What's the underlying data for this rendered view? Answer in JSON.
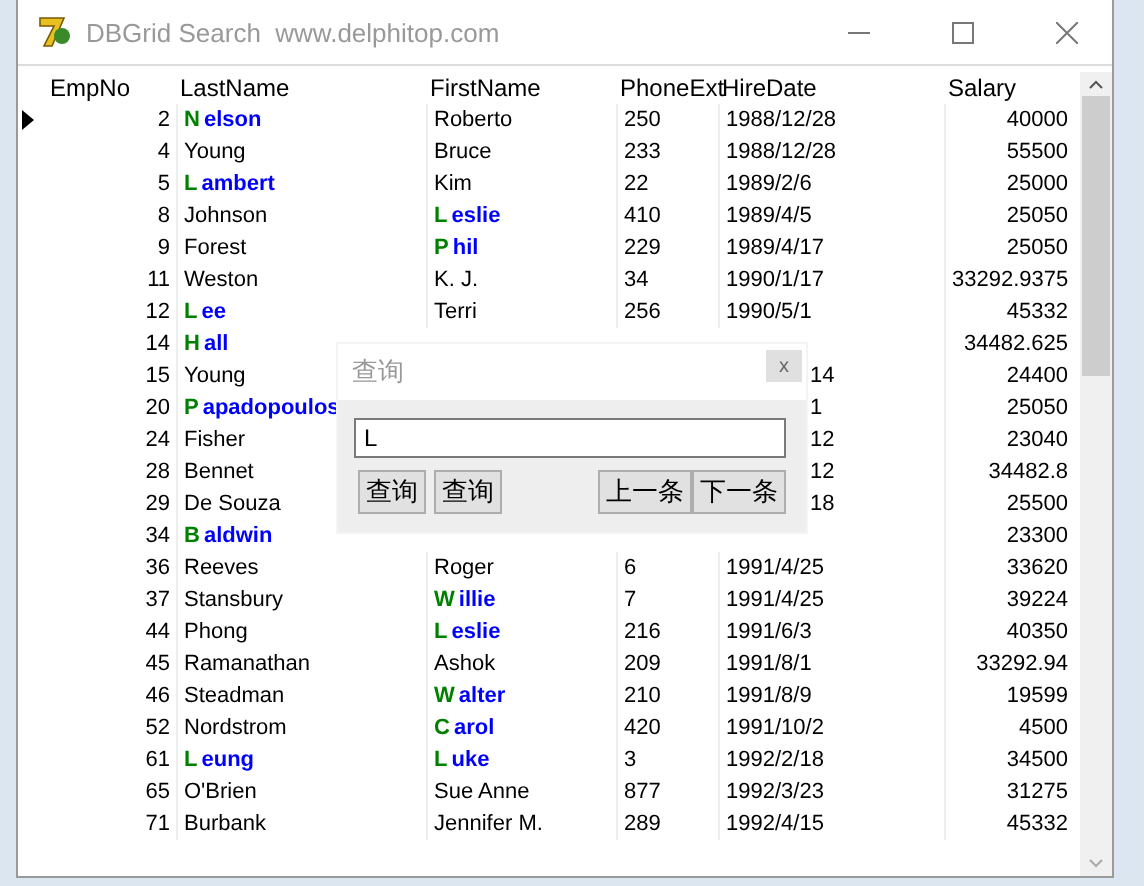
{
  "window": {
    "title": "DBGrid Search  www.delphitop.com"
  },
  "grid": {
    "columns": [
      "EmpNo",
      "LastName",
      "FirstName",
      "PhoneExt",
      "HireDate",
      "Salary"
    ],
    "rows": [
      {
        "current": true,
        "emp": "2",
        "last": {
          "match": "N",
          "rest": "elson"
        },
        "first": {
          "text": "Roberto"
        },
        "phone": "250",
        "hire": "1988/12/28",
        "salary": "40000"
      },
      {
        "current": false,
        "emp": "4",
        "last": {
          "text": "Young"
        },
        "first": {
          "text": "Bruce"
        },
        "phone": "233",
        "hire": "1988/12/28",
        "salary": "55500"
      },
      {
        "current": false,
        "emp": "5",
        "last": {
          "match": "L",
          "rest": "ambert"
        },
        "first": {
          "text": "Kim"
        },
        "phone": "22",
        "hire": "1989/2/6",
        "salary": "25000"
      },
      {
        "current": false,
        "emp": "8",
        "last": {
          "text": "Johnson"
        },
        "first": {
          "match": "L",
          "rest": "eslie"
        },
        "phone": "410",
        "hire": "1989/4/5",
        "salary": "25050"
      },
      {
        "current": false,
        "emp": "9",
        "last": {
          "text": "Forest"
        },
        "first": {
          "match": "P",
          "rest": "hil"
        },
        "phone": "229",
        "hire": "1989/4/17",
        "salary": "25050"
      },
      {
        "current": false,
        "emp": "11",
        "last": {
          "text": "Weston"
        },
        "first": {
          "text": "K. J."
        },
        "phone": "34",
        "hire": "1990/1/17",
        "salary": "33292.9375"
      },
      {
        "current": false,
        "emp": "12",
        "last": {
          "match": "L",
          "rest": "ee"
        },
        "first": {
          "text": "Terri"
        },
        "phone": "256",
        "hire": "1990/5/1",
        "salary": "45332"
      },
      {
        "current": false,
        "emp": "14",
        "last": {
          "match": "H",
          "rest": "all"
        },
        "salary": "34482.625"
      },
      {
        "current": false,
        "emp": "15",
        "last": {
          "text": "Young"
        },
        "hire": "14",
        "salary": "24400"
      },
      {
        "current": false,
        "emp": "20",
        "last": {
          "match": "P",
          "rest": "apadopoulos"
        },
        "hire": "1",
        "salary": "25050"
      },
      {
        "current": false,
        "emp": "24",
        "last": {
          "text": "Fisher"
        },
        "hire": "12",
        "salary": "23040"
      },
      {
        "current": false,
        "emp": "28",
        "last": {
          "text": "Bennet"
        },
        "hire": "12",
        "salary": "34482.8"
      },
      {
        "current": false,
        "emp": "29",
        "last": {
          "text": "De Souza"
        },
        "hire": "18",
        "salary": "25500"
      },
      {
        "current": false,
        "emp": "34",
        "last": {
          "match": "B",
          "rest": "aldwin"
        },
        "salary": "23300"
      },
      {
        "current": false,
        "emp": "36",
        "last": {
          "text": "Reeves"
        },
        "first": {
          "text": "Roger"
        },
        "phone": "6",
        "hire": "1991/4/25",
        "salary": "33620"
      },
      {
        "current": false,
        "emp": "37",
        "last": {
          "text": "Stansbury"
        },
        "first": {
          "match": "W",
          "rest": "illie"
        },
        "phone": "7",
        "hire": "1991/4/25",
        "salary": "39224"
      },
      {
        "current": false,
        "emp": "44",
        "last": {
          "text": "Phong"
        },
        "first": {
          "match": "L",
          "rest": "eslie"
        },
        "phone": "216",
        "hire": "1991/6/3",
        "salary": "40350"
      },
      {
        "current": false,
        "emp": "45",
        "last": {
          "text": "Ramanathan"
        },
        "first": {
          "text": "Ashok"
        },
        "phone": "209",
        "hire": "1991/8/1",
        "salary": "33292.94"
      },
      {
        "current": false,
        "emp": "46",
        "last": {
          "text": "Steadman"
        },
        "first": {
          "match": "W",
          "rest": "alter"
        },
        "phone": "210",
        "hire": "1991/8/9",
        "salary": "19599"
      },
      {
        "current": false,
        "emp": "52",
        "last": {
          "text": "Nordstrom"
        },
        "first": {
          "match": "C",
          "rest": "arol"
        },
        "phone": "420",
        "hire": "1991/10/2",
        "salary": "4500"
      },
      {
        "current": false,
        "emp": "61",
        "last": {
          "match": "L",
          "rest": "eung"
        },
        "first": {
          "match": "L",
          "rest": "uke"
        },
        "phone": "3",
        "hire": "1992/2/18",
        "salary": "34500"
      },
      {
        "current": false,
        "emp": "65",
        "last": {
          "text": "O'Brien"
        },
        "first": {
          "text": "Sue Anne"
        },
        "phone": "877",
        "hire": "1992/3/23",
        "salary": "31275"
      },
      {
        "current": false,
        "emp": "71",
        "last": {
          "text": "Burbank"
        },
        "first": {
          "text": "Jennifer M."
        },
        "phone": "289",
        "hire": "1992/4/15",
        "salary": "45332"
      }
    ]
  },
  "dialog": {
    "title": "查询",
    "close": "x",
    "value": "L",
    "buttons": [
      "查询",
      "查询"
    ],
    "nav_buttons": [
      "上一条",
      "下一条"
    ]
  }
}
